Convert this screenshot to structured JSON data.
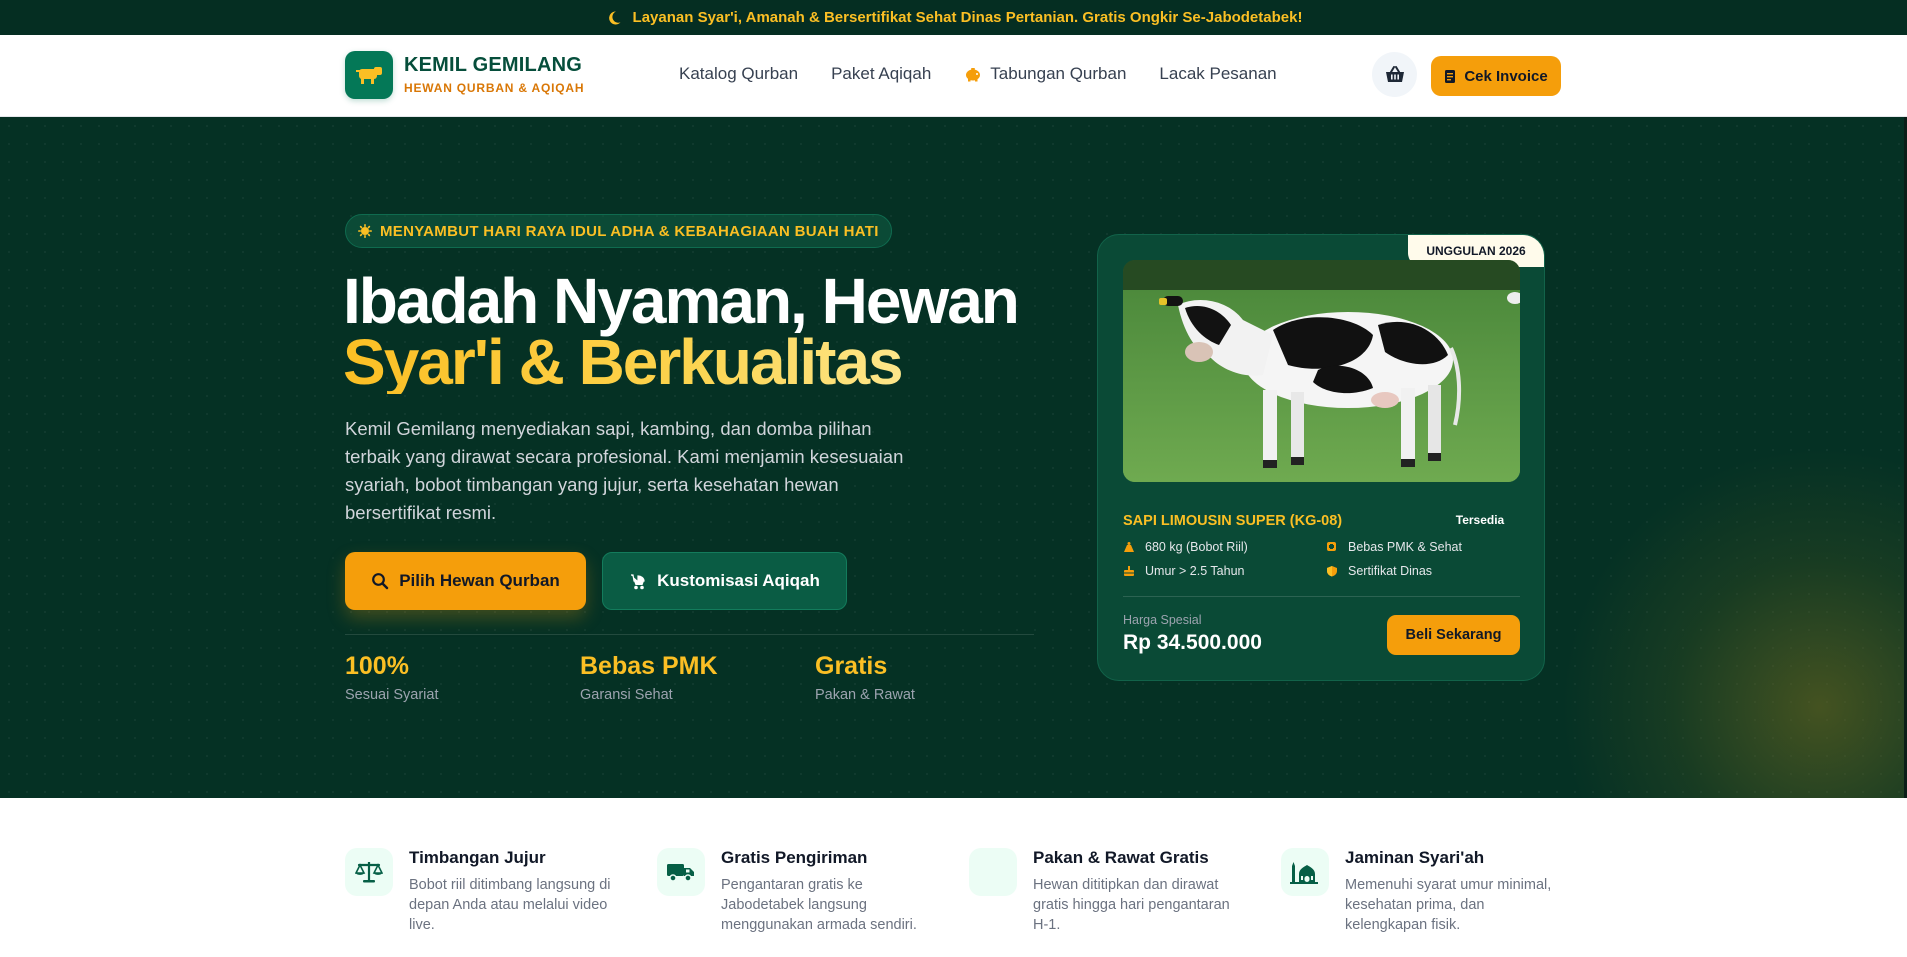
{
  "announcement": "Layanan Syar'i, Amanah & Bersertifikat Sehat Dinas Pertanian. Gratis Ongkir Se-Jabodetabek!",
  "brand": {
    "name": "KEMIL GEMILANG",
    "tagline": "HEWAN QURBAN & AQIQAH"
  },
  "nav": [
    {
      "label": "Katalog Qurban",
      "icon": ""
    },
    {
      "label": "Paket Aqiqah",
      "icon": ""
    },
    {
      "label": "Tabungan Qurban",
      "icon": "piggy-bank-icon"
    },
    {
      "label": "Lacak Pesanan",
      "icon": ""
    }
  ],
  "header_actions": {
    "cart_icon": "basket-icon",
    "invoice_label": "Cek Invoice"
  },
  "hero": {
    "badge": "MENYAMBUT HARI RAYA IDUL ADHA & KEBAHAGIAAN BUAH HATI",
    "title_line1": "Ibadah Nyaman, Hewan",
    "title_line2": "Syar'i & Berkualitas",
    "description": "Kemil Gemilang menyediakan sapi, kambing, dan domba pilihan terbaik yang dirawat secara profesional. Kami menjamin kesesuaian syariah, bobot timbangan yang jujur, serta kesehatan hewan bersertifikat resmi.",
    "primary_button": "Pilih Hewan Qurban",
    "secondary_button": "Kustomisasi Aqiqah",
    "stats": [
      {
        "value": "100%",
        "label": "Sesuai Syariat"
      },
      {
        "value": "Bebas PMK",
        "label": "Garansi Sehat"
      },
      {
        "value": "Gratis",
        "label": "Pakan & Rawat"
      }
    ]
  },
  "featured": {
    "badge": "UNGGULAN 2026",
    "title": "SAPI LIMOUSIN SUPER (KG-08)",
    "status": "Tersedia",
    "features": [
      "680 kg (Bobot Riil)",
      "Bebas PMK & Sehat",
      "Umur > 2.5 Tahun",
      "Sertifikat Dinas"
    ],
    "price_label": "Harga Spesial",
    "price": "Rp 34.500.000",
    "buy_button": "Beli Sekarang"
  },
  "features": [
    {
      "title": "Timbangan Jujur",
      "desc": "Bobot riil ditimbang langsung di depan Anda atau melalui video live.",
      "icon": "scale-icon"
    },
    {
      "title": "Gratis Pengiriman",
      "desc": "Pengantaran gratis ke Jabodetabek langsung menggunakan armada sendiri.",
      "icon": "truck-icon"
    },
    {
      "title": "Pakan & Rawat Gratis",
      "desc": "Hewan dititipkan dan dirawat gratis hingga hari pengantaran H-1.",
      "icon": ""
    },
    {
      "title": "Jaminan Syari'ah",
      "desc": "Memenuhi syarat umur minimal, kesehatan prima, dan kelengkapan fisik.",
      "icon": "mosque-icon"
    }
  ],
  "colors": {
    "dark_green": "#053124",
    "accent": "#f59e0b",
    "gold": "#fbbf24",
    "brand_green": "#047857"
  }
}
